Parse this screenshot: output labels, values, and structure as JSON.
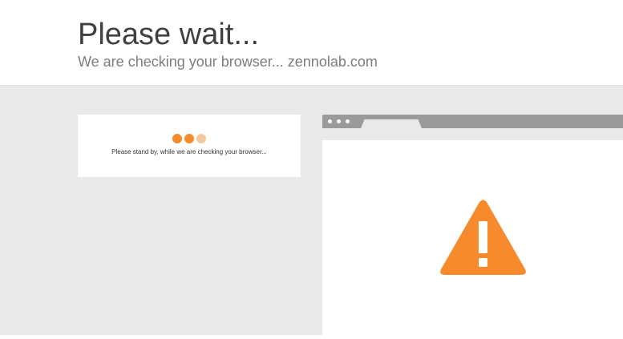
{
  "header": {
    "title": "Please wait...",
    "subtitle": "We are checking your browser... zennolab.com"
  },
  "card": {
    "message": "Please stand by, while we are checking your browser...",
    "loading_dots_colors": [
      "#f68a2c",
      "#f68a2c",
      "#f9c79c"
    ]
  },
  "browser_illustration": {
    "icon": "warning-icon",
    "icon_color": "#f68a2c"
  },
  "colors": {
    "background_gray": "#e9e9e9",
    "browser_bar": "#9a9a9a",
    "accent": "#f68a2c"
  }
}
